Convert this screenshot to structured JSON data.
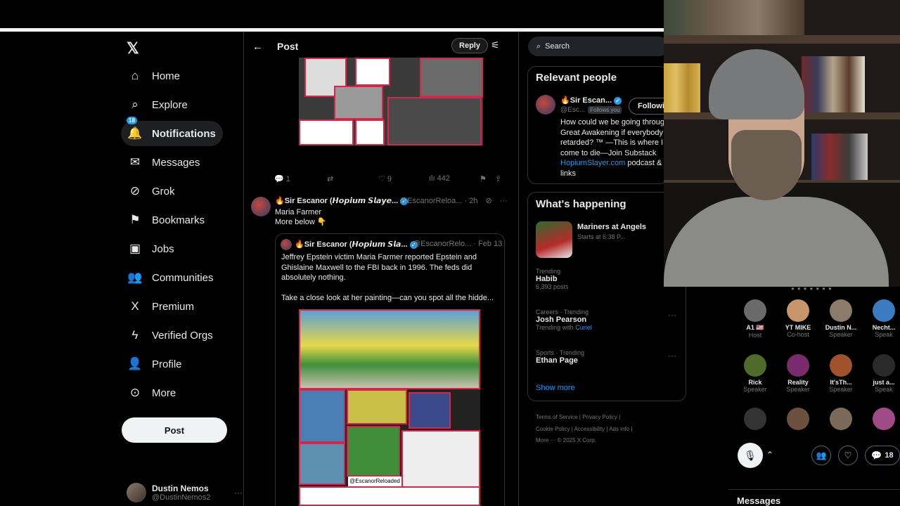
{
  "nav": {
    "items": [
      {
        "label": "Home",
        "icon": "home-icon",
        "glyph": "⌂"
      },
      {
        "label": "Explore",
        "icon": "search-icon",
        "glyph": "⌕"
      },
      {
        "label": "Notifications",
        "icon": "bell-icon",
        "glyph": "🔔",
        "badge": "18"
      },
      {
        "label": "Messages",
        "icon": "envelope-icon",
        "glyph": "✉"
      },
      {
        "label": "Grok",
        "icon": "grok-icon",
        "glyph": "⊘"
      },
      {
        "label": "Bookmarks",
        "icon": "bookmark-icon",
        "glyph": "⚑"
      },
      {
        "label": "Jobs",
        "icon": "briefcase-icon",
        "glyph": "▣"
      },
      {
        "label": "Communities",
        "icon": "people-icon",
        "glyph": "👥"
      },
      {
        "label": "Premium",
        "icon": "x-logo-icon",
        "glyph": "X"
      },
      {
        "label": "Verified Orgs",
        "icon": "lightning-icon",
        "glyph": "ϟ"
      },
      {
        "label": "Profile",
        "icon": "person-icon",
        "glyph": "👤"
      },
      {
        "label": "More",
        "icon": "more-circle-icon",
        "glyph": "⊙"
      }
    ],
    "post_label": "Post",
    "account": {
      "name": "Dustin Nemos",
      "handle": "@DustinNemos2"
    }
  },
  "header": {
    "title": "Post",
    "reply_label": "Reply"
  },
  "first_tweet_actions": {
    "replies": "1",
    "likes": "9",
    "views": "442"
  },
  "tweet": {
    "name": "🔥Sir Escanor (𝙃𝙤𝙥𝙞𝙪𝙢 𝙎𝙡𝙖𝙮𝙚...",
    "handle": "@EscanorReloa... · 2h",
    "line1": "Maria Farmer",
    "line2": "More below 👇"
  },
  "quote": {
    "name": "🔥Sir Escanor (𝙃𝙤𝙥𝙞𝙪𝙢 𝙎𝙡𝙖...",
    "handle": "@EscanorRelo... · Feb 13",
    "text1": "Jeffrey Epstein victim Maria Farmer reported Epstein and Ghislaine Maxwell to the FBI back in 1996. The feds did absolutely nothing.",
    "text2": "Take a close look at her painting—can you spot all the hidde...",
    "watermark": "@EscanorReloaded"
  },
  "search": {
    "placeholder": "Search"
  },
  "relevant": {
    "title": "Relevant people",
    "name": "🔥Sir Escan...",
    "handle": "@Esc...",
    "follows_you": "Follows you",
    "following_label": "Followin",
    "bio1": "How could we be going throug Great Awakening if everybody retarded? ™ —This is where I come to die—Join Substack",
    "bio_link": "HopiumSlayer.com",
    "bio2": " podcast & links"
  },
  "happening": {
    "title": "What's happening",
    "event": "Mariners at Angels",
    "event_sub": "Starts at 6:38 P...",
    "trends": [
      {
        "cat": "Trending",
        "name": "Habib",
        "sub": "6,393 posts"
      },
      {
        "cat": "Careers · Trending",
        "name": "Josh Pearson",
        "sub_pre": "Trending with ",
        "sub_link": "Curiel"
      },
      {
        "cat": "Sports · Trending",
        "name": "Ethan Page",
        "sub": ""
      }
    ],
    "show_more": "Show more"
  },
  "footer": {
    "row1": "Terms of Service  |  Privacy Policy  |",
    "row2": "Cookie Policy  |  Accessibility  |  Ads info  |",
    "row3": "More ···  © 2025 X Corp."
  },
  "spaces": {
    "participants": [
      {
        "name": "A1 🇺🇸",
        "role": "Host",
        "color": "#6a6a6a"
      },
      {
        "name": "YT MIKE",
        "role": "Co-host",
        "color": "#c9956b"
      },
      {
        "name": "Dustin N...",
        "role": "Speaker",
        "color": "#8a7b6b"
      },
      {
        "name": "Necht...",
        "role": "Speak",
        "color": "#3b7bbf"
      },
      {
        "name": "Rick",
        "role": "Speaker",
        "color": "#4f6b2a"
      },
      {
        "name": "Reality",
        "role": "Speaker",
        "color": "#7a2b6b"
      },
      {
        "name": "It'sTh...",
        "role": "Speaker",
        "color": "#a0522d"
      },
      {
        "name": "just a...",
        "role": "Speak",
        "color": "#2a2a2a"
      }
    ],
    "listener_count": "18",
    "messages_label": "Messages"
  }
}
